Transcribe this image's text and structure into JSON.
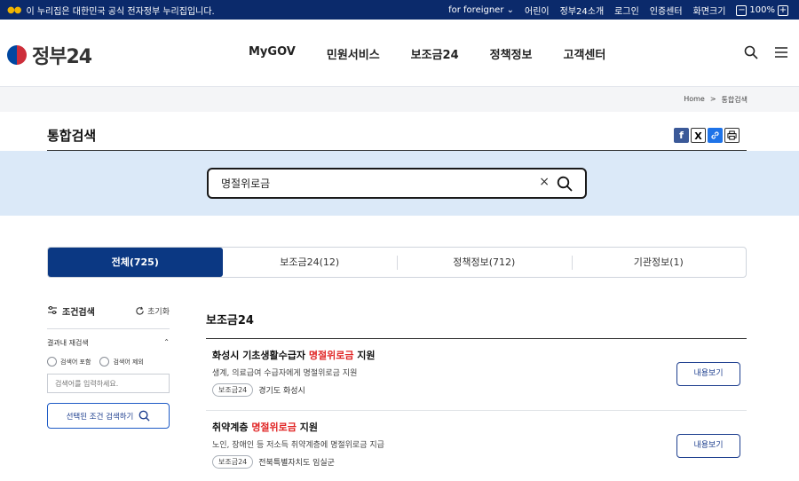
{
  "topbar": {
    "gov_notice": "이 누리집은 대한민국 공식 전자정부 누리집입니다.",
    "foreigner": "for foreigner",
    "links": [
      "어린이",
      "정부24소개",
      "로그인",
      "인증센터",
      "화면크기"
    ],
    "zoom_minus": "−",
    "zoom_value": "100%",
    "zoom_plus": "+"
  },
  "header": {
    "logo_text": "정부24",
    "nav": [
      "MyGOV",
      "민원서비스",
      "보조금24",
      "정책정보",
      "고객센터"
    ]
  },
  "breadcrumb": {
    "home": "Home",
    "sep": ">",
    "current": "통합검색"
  },
  "page": {
    "title": "통합검색"
  },
  "share": {
    "facebook": "f",
    "x": "X",
    "link": "🔗",
    "print": "⎙"
  },
  "search": {
    "value": "명절위로금",
    "clear": "×"
  },
  "tabs": [
    {
      "label": "전체(725)",
      "active": true
    },
    {
      "label": "보조금24(12)",
      "active": false
    },
    {
      "label": "정책정보(712)",
      "active": false
    },
    {
      "label": "기관정보(1)",
      "active": false
    }
  ],
  "filter": {
    "title": "조건검색",
    "reset": "초기화",
    "section": "결과내 재검색",
    "include": "검색어 포함",
    "exclude": "검색어 제외",
    "placeholder": "검색어를 입력하세요.",
    "apply": "선택된 조건 검색하기"
  },
  "results": {
    "heading": "보조금24",
    "items": [
      {
        "title_before": "화성시 기초생활수급자 ",
        "title_highlight": "명절위로금",
        "title_after": " 지원",
        "desc": "생계, 의료급여 수급자에게 명절위로금 지원",
        "tag": "보조금24",
        "org": "경기도 화성시",
        "button": "내용보기"
      },
      {
        "title_before": "취약계층 ",
        "title_highlight": "명절위로금",
        "title_after": " 지원",
        "desc": "노인, 장애인 등 저소득 취약계층에 명절위로금 지급",
        "tag": "보조금24",
        "org": "전북특별자치도 임실군",
        "button": "내용보기"
      }
    ]
  }
}
